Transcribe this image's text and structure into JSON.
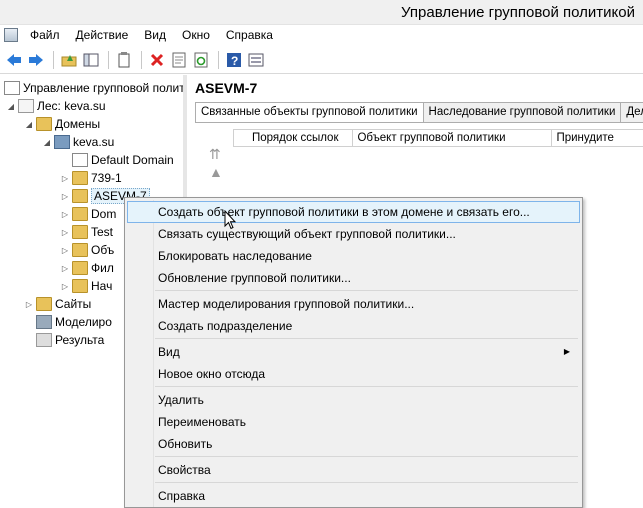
{
  "window": {
    "title": "Управление групповой политикой"
  },
  "menu": [
    "Файл",
    "Действие",
    "Вид",
    "Окно",
    "Справка"
  ],
  "toolbar": {
    "icons": [
      "back-icon",
      "forward-icon",
      "up-folder-icon",
      "show-hide-tree-icon",
      "clipboard-icon",
      "delete-icon",
      "properties-icon",
      "refresh-icon",
      "help-icon",
      "console-icon"
    ]
  },
  "tree": {
    "root": "Управление групповой полити",
    "forest": "Лес: keva.su",
    "domains": "Домены",
    "domain": "keva.su",
    "default_policy": "Default Domain",
    "ou_739": "739-1",
    "ou_asevm": "ASEVM-7",
    "ou_dom": "Dom",
    "ou_test": "Test",
    "ou_obj": "Объ",
    "ou_fil": "Фил",
    "ou_nach": "Нач",
    "sites": "Сайты",
    "modeling": "Моделиро",
    "results": "Результа"
  },
  "details": {
    "title": "ASEVM-7",
    "tabs": [
      "Связанные объекты групповой политики",
      "Наследование групповой политики",
      "Делег"
    ],
    "columns": [
      "Порядок ссылок",
      "Объект групповой политики",
      "Принудите"
    ]
  },
  "context_menu": {
    "items": [
      "Создать объект групповой политики в этом домене и связать его...",
      "Связать существующий объект групповой политики...",
      "Блокировать наследование",
      "Обновление групповой политики...",
      "Мастер моделирования групповой политики...",
      "Создать подразделение",
      "Вид",
      "Новое окно отсюда",
      "Удалить",
      "Переименовать",
      "Обновить",
      "Свойства",
      "Справка"
    ]
  }
}
